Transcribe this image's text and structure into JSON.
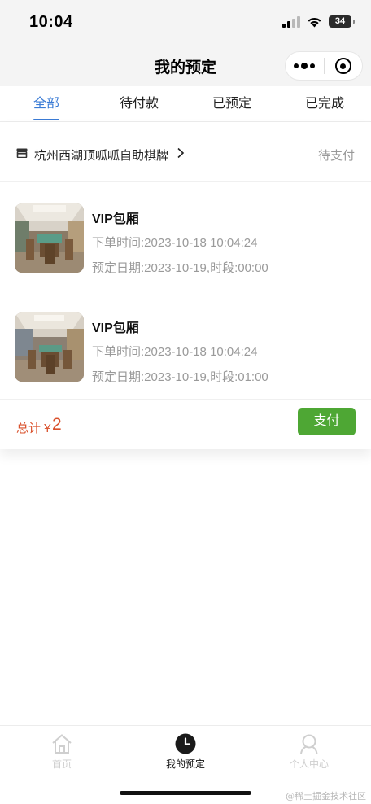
{
  "status_bar": {
    "time": "10:04",
    "battery_level": "34"
  },
  "nav": {
    "title": "我的预定"
  },
  "tabs": [
    {
      "label": "全部",
      "active": true
    },
    {
      "label": "待付款",
      "active": false
    },
    {
      "label": "已预定",
      "active": false
    },
    {
      "label": "已完成",
      "active": false
    }
  ],
  "order": {
    "shop_name": "杭州西湖顶呱呱自助棋牌",
    "status": "待支付",
    "items": [
      {
        "name": "VIP包厢",
        "order_time": "下单时间:2023-10-18 10:04:24",
        "booking_date": "预定日期:2023-10-19,时段:00:00"
      },
      {
        "name": "VIP包厢",
        "order_time": "下单时间:2023-10-18 10:04:24",
        "booking_date": "预定日期:2023-10-19,时段:01:00"
      }
    ],
    "total_label": "总计 ¥",
    "total_value": "2",
    "pay_label": "支付"
  },
  "tabbar": [
    {
      "label": "首页",
      "icon": "home-icon",
      "active": false
    },
    {
      "label": "我的预定",
      "icon": "clock-icon",
      "active": true
    },
    {
      "label": "个人中心",
      "icon": "person-icon",
      "active": false
    }
  ],
  "watermark": "@稀土掘金技术社区",
  "colors": {
    "accent": "#3a7bd5",
    "price": "#d9502b",
    "pay_button": "#4ea734"
  }
}
